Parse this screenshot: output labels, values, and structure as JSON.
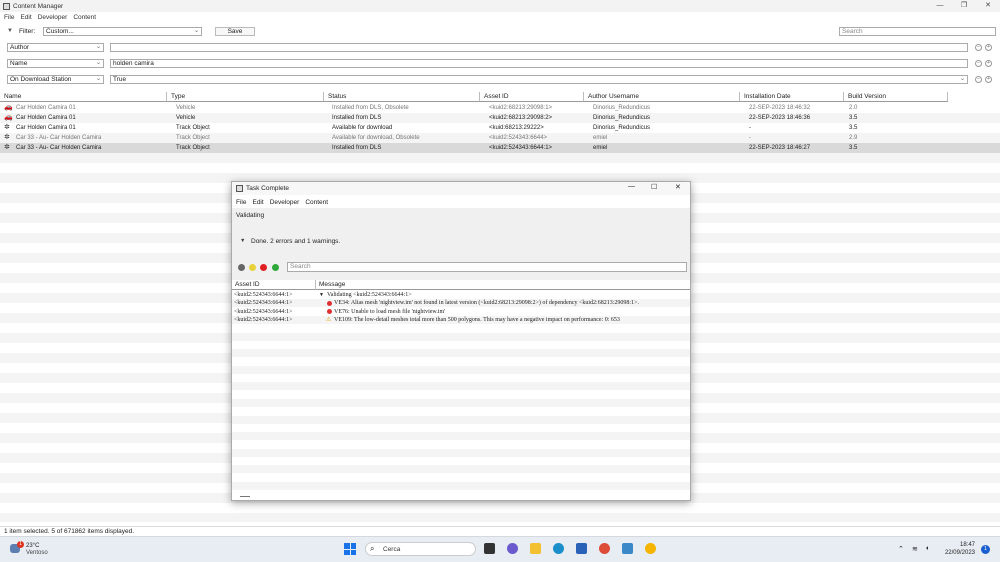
{
  "window": {
    "title": "Content Manager"
  },
  "menu": [
    "File",
    "Edit",
    "Developer",
    "Content"
  ],
  "filter": {
    "label": "Filter:",
    "preset": "Custom...",
    "save_label": "Save",
    "search_placeholder": "Search"
  },
  "criteria": [
    {
      "field": "Author",
      "value": ""
    },
    {
      "field": "Name",
      "value": "holden camira"
    },
    {
      "field": "On Download Station",
      "value": "True"
    }
  ],
  "columns": [
    "Name",
    "Type",
    "Status",
    "Asset ID",
    "Author Username",
    "Installation Date",
    "Build Version"
  ],
  "rows": [
    {
      "name": "Car Holden Camira 01",
      "type": "Vehicle",
      "status": "Installed from DLS, Obsolete",
      "asset": "<kuid2:68213:29098:1>",
      "author": "Dinorius_Redundicus",
      "date": "22-SEP-2023 18:46:32",
      "build": "2.0",
      "dim": true,
      "bold": false
    },
    {
      "name": "Car Holden Camira 01",
      "type": "Vehicle",
      "status": "Installed from DLS",
      "asset": "<kuid2:68213:29098:2>",
      "author": "Dinorius_Redundicus",
      "date": "22-SEP-2023 18:46:36",
      "build": "3.5",
      "dim": false,
      "bold": false
    },
    {
      "name": "Car Holden Camira 01",
      "type": "Track Object",
      "status": "Available for download",
      "asset": "<kuid:68213:29222>",
      "author": "Dinorius_Redundicus",
      "date": "-",
      "build": "3.5",
      "dim": false,
      "bold": false
    },
    {
      "name": "Car 33 - Au- Car Holden Camira",
      "type": "Track Object",
      "status": "Available for download, Obsolete",
      "asset": "<kuid2:524343:6644>",
      "author": "emiel",
      "date": "-",
      "build": "2.9",
      "dim": true,
      "bold": false
    },
    {
      "name": "Car 33 - Au- Car Holden Camira",
      "type": "Track Object",
      "status": "Installed from DLS",
      "asset": "<kuid2:524343:6644:1>",
      "author": "emiel",
      "date": "22-SEP-2023 18:46:27",
      "build": "3.5",
      "dim": false,
      "bold": false
    }
  ],
  "status_text": "1 item selected. 5 of 671862 items displayed.",
  "dialog": {
    "title": "Task Complete",
    "menu": [
      "File",
      "Edit",
      "Developer",
      "Content"
    ],
    "task": "Validating",
    "summary": "Done. 2 errors and 1 warnings.",
    "search_placeholder": "Search",
    "columns": [
      "Asset ID",
      "Message"
    ],
    "messages": [
      {
        "asset": "<kuid2:524343:6644:1>",
        "icon": "expand",
        "text": "Validating <kuid2:524343:6644:1>"
      },
      {
        "asset": "<kuid2:524343:6644:1>",
        "icon": "error",
        "text": "VE34: Alias mesh 'nightview.im' not found in latest version (<kuid2:68213:29098:2>) of dependency <kuid2:68213:29098:1>."
      },
      {
        "asset": "<kuid2:524343:6644:1>",
        "icon": "error",
        "text": "VE76: Unable to load mesh file 'nightview.im'"
      },
      {
        "asset": "<kuid2:524343:6644:1>",
        "icon": "warning",
        "text": "VE109: The low-detail meshes total more than 500 polygons. This may have a negative impact on performance: 0: 653"
      }
    ]
  },
  "taskbar": {
    "weather_temp": "23°C",
    "weather_desc": "Ventoso",
    "search": "Cerca",
    "time": "18:47",
    "date": "22/09/2023",
    "notif": "1",
    "weather_badge": "1"
  },
  "colors": {
    "selected_row": "#d9d9d9",
    "error": "#e03030",
    "warning": "#e0a000",
    "dialog_title": "#e8f3e8"
  }
}
